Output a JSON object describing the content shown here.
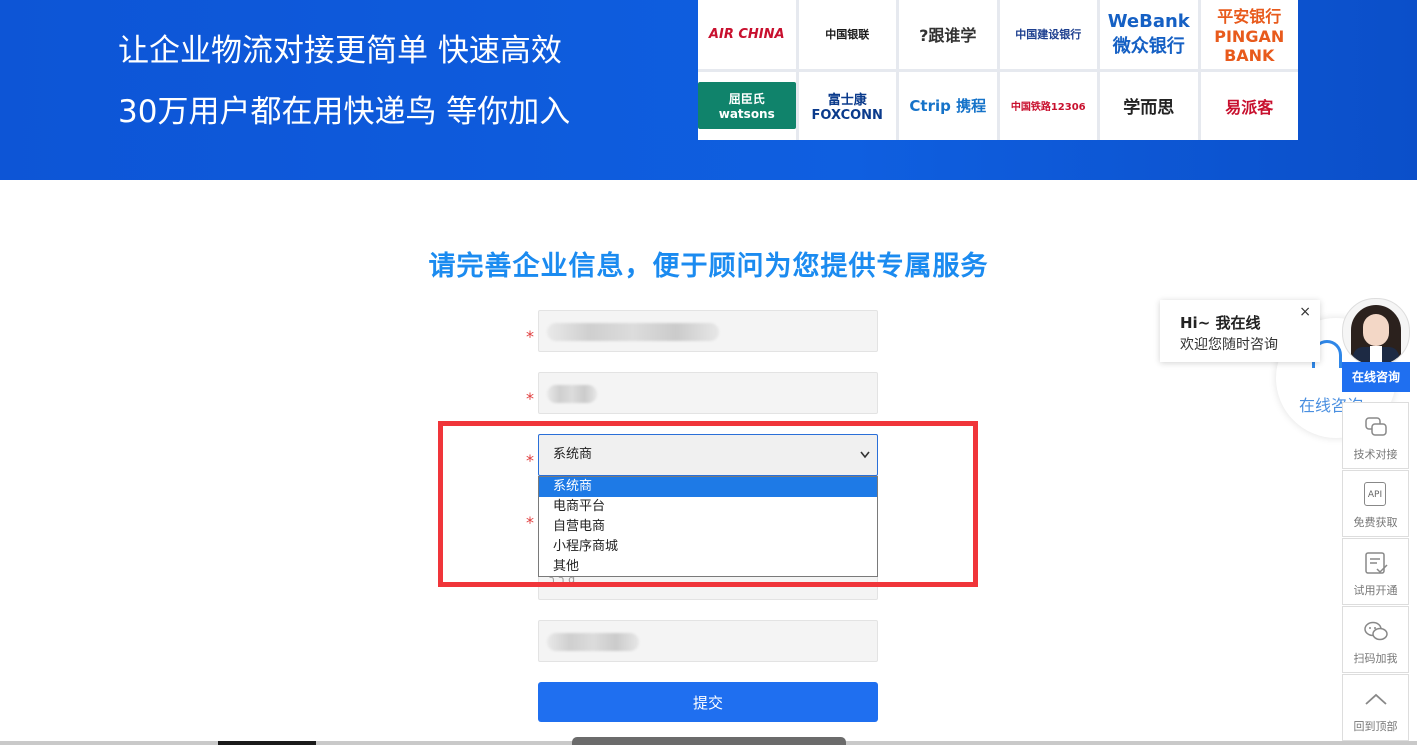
{
  "banner": {
    "slogan_line1": "让企业物流对接更简单 快速高效",
    "slogan_line2": "30万用户都在用快递鸟 等你加入",
    "partners": [
      "AIR CHINA",
      "中国银联",
      "?跟谁学",
      "中国建设银行",
      "WeBank 微众银行",
      "平安银行 PINGAN BANK",
      "屈臣氏 watsons",
      "富士康 FOXCONN",
      "Ctrip 携程",
      "中国铁路12306",
      "学而思",
      "易派客"
    ]
  },
  "form": {
    "title": "请完善企业信息，便于顾问为您提供专属服务",
    "required_mark": "*",
    "select": {
      "selected": "系统商",
      "options": [
        "系统商",
        "电商平台",
        "自营电商",
        "小程序商城",
        "其他"
      ]
    },
    "partial_text": "ר ך g",
    "submit_label": "提交"
  },
  "chat": {
    "greeting": "Hi~ 我在线",
    "subtitle": "欢迎您随时咨询",
    "close": "×",
    "online_text": "在线咨询",
    "online_button": "在线咨询"
  },
  "sidebar": {
    "items": [
      {
        "label": "技术对接",
        "icon": "chat-bubbles-icon"
      },
      {
        "label": "免费获取",
        "icon": "api-icon"
      },
      {
        "label": "试用开通",
        "icon": "checklist-icon"
      },
      {
        "label": "扫码加我",
        "icon": "wechat-icon"
      },
      {
        "label": "回到顶部",
        "icon": "arrow-up-icon"
      }
    ],
    "api_text": "API"
  },
  "colors": {
    "banner_blue": "#0f5fe0",
    "title_blue": "#1b8bf0",
    "primary": "#1f6ff0",
    "highlight_red": "#f0353a"
  }
}
